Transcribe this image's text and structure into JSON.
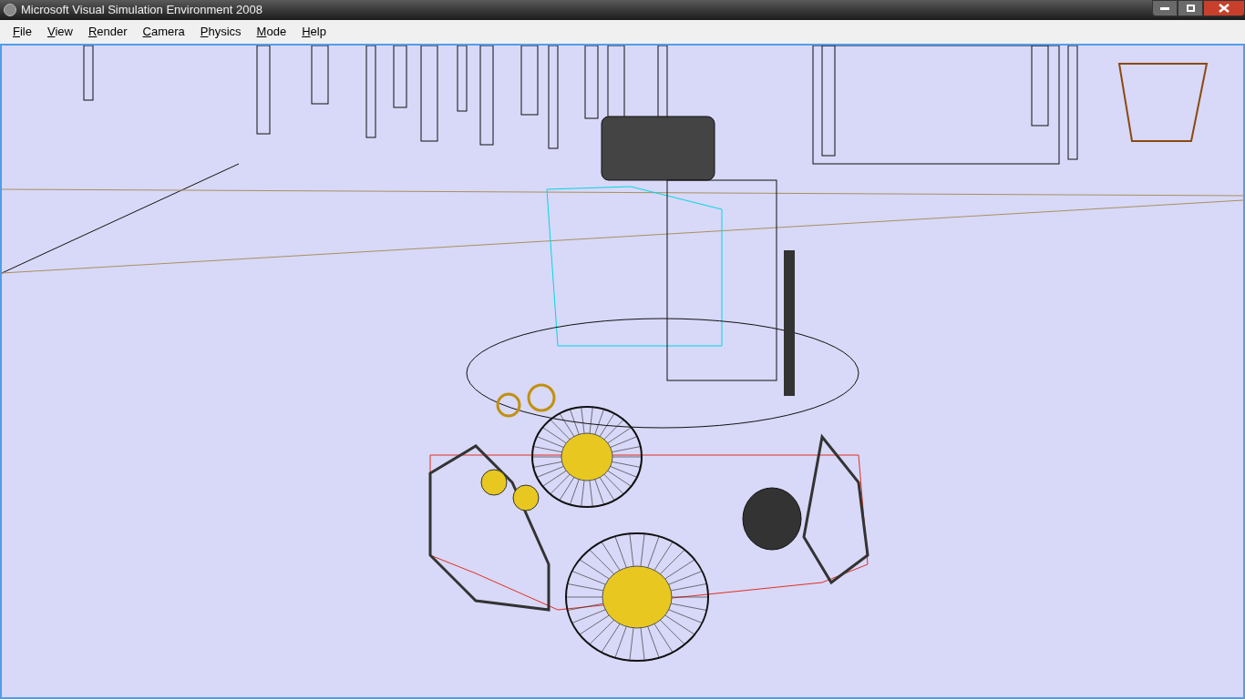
{
  "window": {
    "title": "Microsoft Visual Simulation Environment 2008"
  },
  "menu": [
    {
      "label": "File"
    },
    {
      "label": "View"
    },
    {
      "label": "Render"
    },
    {
      "label": "Camera"
    },
    {
      "label": "Physics"
    },
    {
      "label": "Mode"
    },
    {
      "label": "Help"
    }
  ]
}
